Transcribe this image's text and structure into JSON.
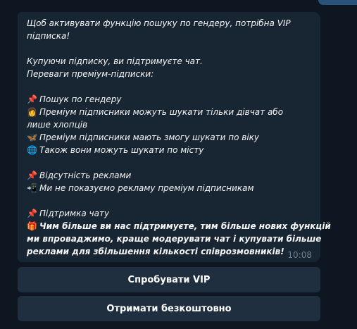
{
  "message": {
    "lines": [
      "Щоб активувати функцію пошуку по гендеру, потрібна VIP",
      "підписка!",
      "Купуючи підписку, ви підтримуєте чат.",
      "Переваги преміум-підписки:",
      "Пошук по гендеру",
      "Преміум підписники можуть шукати тільки дівчат або",
      "лише хлопців",
      "Преміум підписники мають змогу шукати по віку",
      "Також вони можуть шукати по місту",
      "Відсутність реклами",
      "Ми не показуємо рекламу преміум підписникам",
      "Підтримка чату",
      "Чим більше ви нас підтримуєте, тим більше нових функцій",
      "ми впроваджимо, краще модерувати чат і купувати більше",
      "реклами для збільшення кількості співрозмовників!"
    ],
    "emoji": {
      "pin": "📌",
      "woman": "👩",
      "butterfly": "🦋",
      "globe": "🌐",
      "phone": "📲",
      "gift": "🎁"
    },
    "time": "10:08"
  },
  "buttons": {
    "try_vip": "Спробувати VIP",
    "get_free": "Отримати безкоштовно"
  },
  "colors": {
    "background": "#0e1621",
    "bubble": "#182533",
    "button": "#1f2f3f",
    "text": "#f5f5f5",
    "timestamp": "#6d7f8f"
  }
}
